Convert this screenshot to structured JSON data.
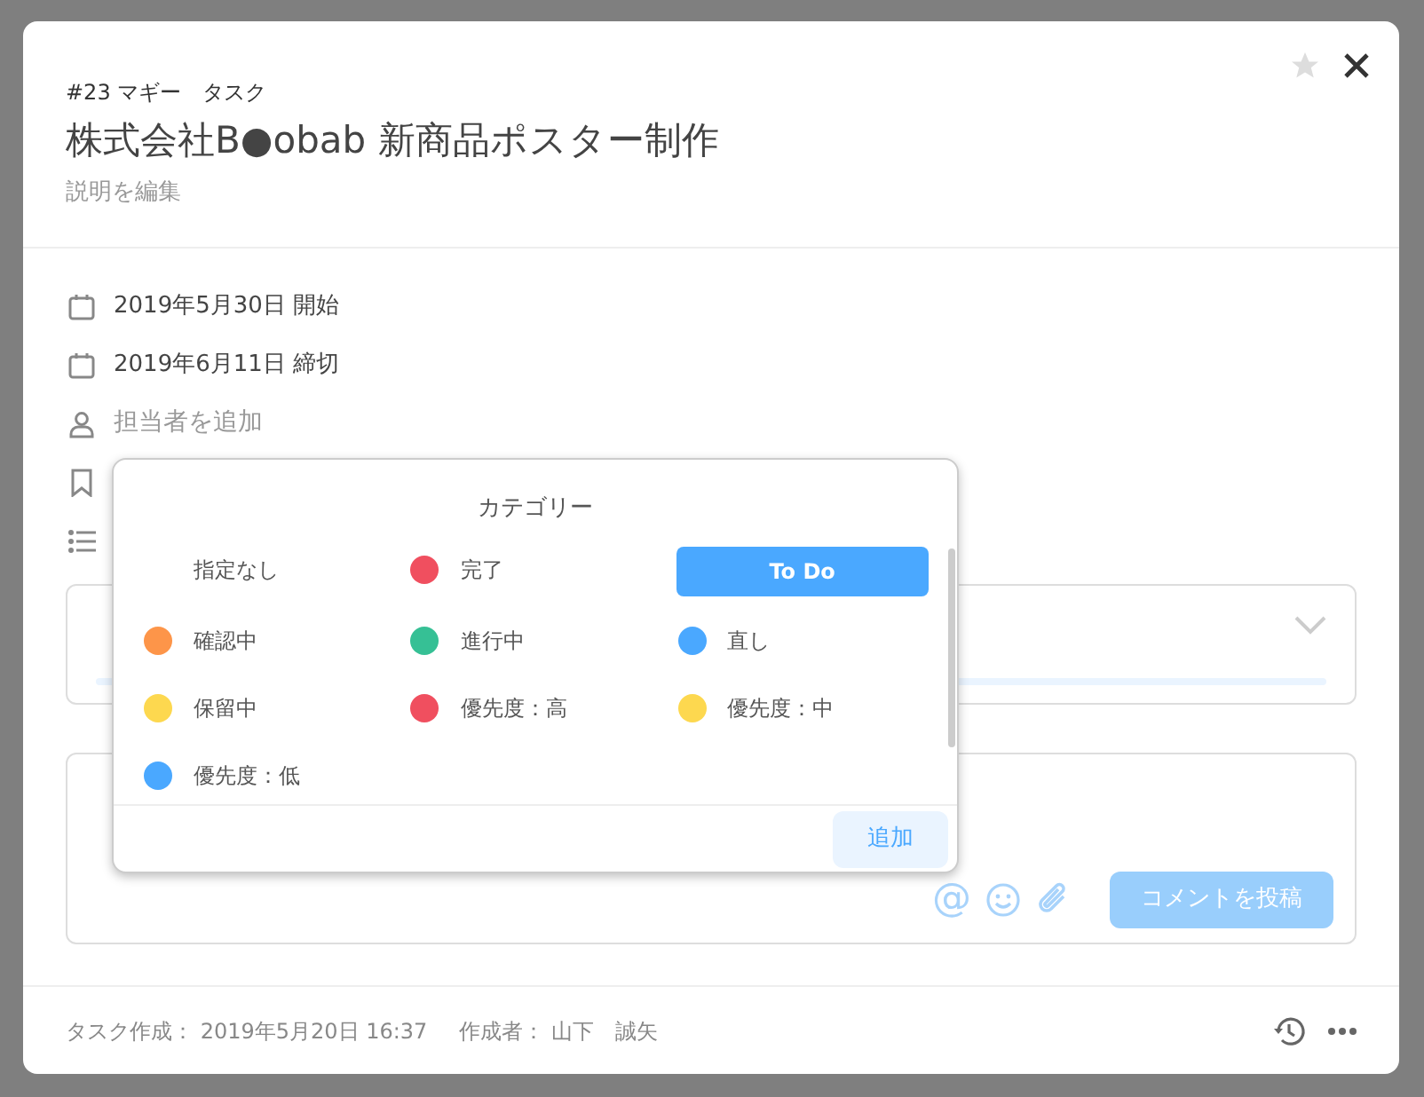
{
  "task": {
    "subtitle": "#23 マギー　タスク",
    "title": "株式会社B●obab 新商品ポスター制作",
    "description_link": "説明を編集",
    "starred": false
  },
  "details": [
    {
      "kind": "date",
      "text": "2019年5月30日 開始"
    },
    {
      "kind": "date",
      "text": "2019年6月11日 締切"
    },
    {
      "kind": "assignee",
      "text": "担当者を追加"
    },
    {
      "kind": "category"
    },
    {
      "kind": "checklist"
    }
  ],
  "comment": {
    "mention_symbol": "@",
    "submit": "コメントを投稿"
  },
  "category_popup": {
    "title": "カテゴリー",
    "add_button": "追加",
    "items": [
      {
        "label": "指定なし",
        "selected": false
      },
      {
        "label": "完了",
        "color": "#f04f5f",
        "selected": false
      },
      {
        "label": "To Do",
        "selected": true
      },
      {
        "label": "確認中",
        "color": "#fd9549",
        "selected": false
      },
      {
        "label": "進行中",
        "color": "#36c095",
        "selected": false
      },
      {
        "label": "直し",
        "color": "#4aa8ff",
        "selected": false
      },
      {
        "label": "保留中",
        "color": "#fdd84f",
        "selected": false
      },
      {
        "label": "優先度：高",
        "color": "#f04f5f",
        "selected": false
      },
      {
        "label": "優先度：中",
        "color": "#fdd84f",
        "selected": false
      },
      {
        "label": "優先度：低",
        "color": "#4aa8ff",
        "selected": false
      }
    ]
  },
  "footer": {
    "created": "タスク作成： 2019年5月20日 16:37",
    "author": "作成者： 山下　誠矢"
  }
}
